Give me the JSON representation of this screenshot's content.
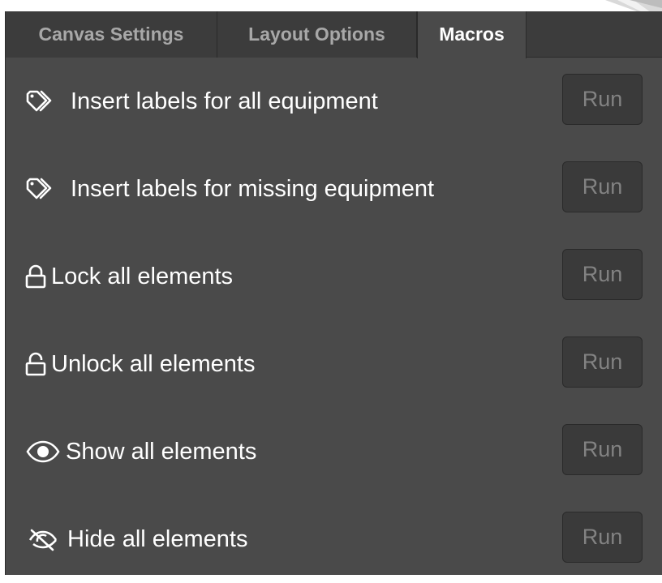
{
  "tabs": [
    {
      "label": "Canvas Settings",
      "active": false
    },
    {
      "label": "Layout Options",
      "active": false
    },
    {
      "label": "Macros",
      "active": true
    }
  ],
  "macros": [
    {
      "icon": "tag-icon",
      "label": "Insert labels for all equipment",
      "button": "Run"
    },
    {
      "icon": "tag-icon",
      "label": "Insert labels for missing equipment",
      "button": "Run"
    },
    {
      "icon": "lock-icon",
      "label": "Lock all elements",
      "button": "Run"
    },
    {
      "icon": "unlock-icon",
      "label": "Unlock all elements",
      "button": "Run"
    },
    {
      "icon": "eye-icon",
      "label": "Show all elements",
      "button": "Run"
    },
    {
      "icon": "eye-off-icon",
      "label": "Hide all elements",
      "button": "Run"
    }
  ],
  "colors": {
    "panel_bg": "#4a4a4a",
    "tab_bar_bg": "#3c3c3c",
    "button_bg": "#3a3a3a",
    "button_text": "#828282",
    "label_text": "#ffffff"
  }
}
